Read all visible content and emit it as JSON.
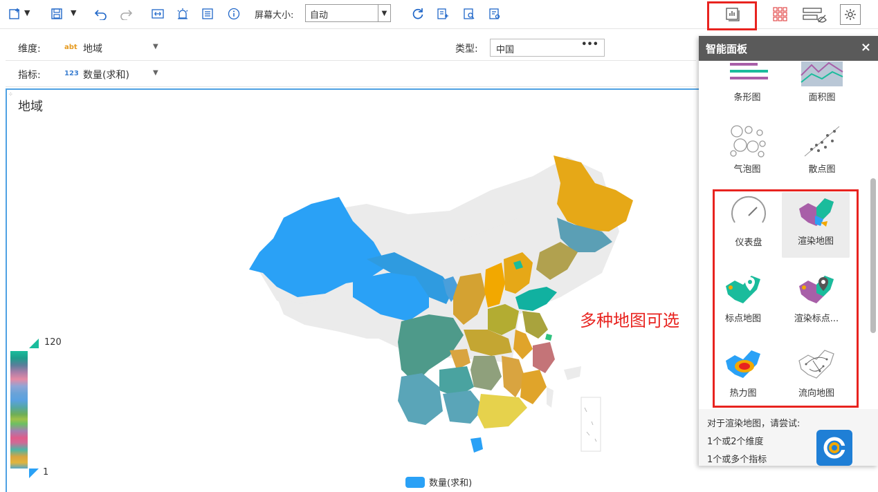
{
  "toolbar": {
    "screen_size_label": "屏幕大小:",
    "screen_size_value": "自动",
    "icons": [
      "add-component-icon",
      "save-icon",
      "undo-icon",
      "redo-icon",
      "link-icon",
      "alert-icon",
      "report-icon",
      "info-icon",
      "refresh-icon",
      "export-icon",
      "preview-icon",
      "settings-icon",
      "smart-panel-icon",
      "grid-icon",
      "hide-icon",
      "gear-icon"
    ]
  },
  "dimension": {
    "label": "维度:",
    "type_badge": "abt",
    "field": "地域"
  },
  "measure": {
    "label": "指标:",
    "type_badge": "123",
    "field": "数量(求和)"
  },
  "map_type": {
    "label": "类型:",
    "value": "中国",
    "more": "•••"
  },
  "chart": {
    "title": "地域",
    "legend_label": "数量(求和)",
    "scale_max": "120",
    "scale_min": "1",
    "colors": {
      "accent": "#2aa1f6",
      "highlight": "#e8231f"
    }
  },
  "chart_data": {
    "type": "map",
    "title": "地域",
    "map_region": "中国",
    "series": [
      {
        "name": "数量(求和)"
      }
    ],
    "visual_map": {
      "min": 1,
      "max": 120
    }
  },
  "annotation": "多种地图可选",
  "panel": {
    "title": "智能面板",
    "close": "×",
    "items": [
      {
        "label": "条形图",
        "icon": "bar-chart-icon"
      },
      {
        "label": "面积图",
        "icon": "area-chart-icon"
      },
      {
        "label": "气泡图",
        "icon": "bubble-chart-icon"
      },
      {
        "label": "散点图",
        "icon": "scatter-chart-icon"
      },
      {
        "label": "仪表盘",
        "icon": "gauge-icon"
      },
      {
        "label": "渲染地图",
        "icon": "render-map-icon"
      },
      {
        "label": "标点地图",
        "icon": "point-map-icon"
      },
      {
        "label": "渲染标点...",
        "icon": "render-point-map-icon"
      },
      {
        "label": "热力图",
        "icon": "heat-map-icon"
      },
      {
        "label": "流向地图",
        "icon": "flow-map-icon"
      }
    ],
    "footer": {
      "line1": "对于渲染地图，请尝试:",
      "line2": "1个或2个维度",
      "line3": "1个或多个指标"
    }
  }
}
